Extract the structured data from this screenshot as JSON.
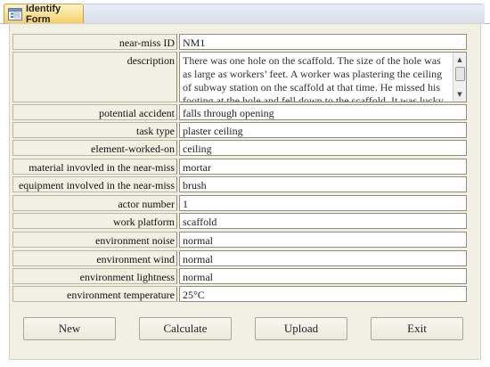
{
  "tab": {
    "icon": "form-icon",
    "title": "Identify Form"
  },
  "fields": [
    {
      "label": "near-miss ID",
      "value": "NM1"
    },
    {
      "label": "description",
      "value": "There was one hole on the scaffold. The size of the hole was as large as workers’ feet. A worker was plastering the ceiling of subway station on the scaffold at that time. He missed his footing at the hole and fell down to the scaffold. It was lucky"
    },
    {
      "label": "potential accident",
      "value": "falls through opening"
    },
    {
      "label": "task type",
      "value": "plaster ceiling"
    },
    {
      "label": "element-worked-on",
      "value": "ceiling"
    },
    {
      "label": "material invovled in the near-miss",
      "value": "mortar"
    },
    {
      "label": "equipment involved in the near-miss",
      "value": "brush"
    },
    {
      "label": "actor number",
      "value": "1"
    },
    {
      "label": "work platform",
      "value": "scaffold"
    },
    {
      "label": "environment noise",
      "value": "normal"
    },
    {
      "label": "environment wind",
      "value": "normal"
    },
    {
      "label": "environment lightness",
      "value": "normal"
    },
    {
      "label": "environment temperature",
      "value": "25°C"
    }
  ],
  "buttons": {
    "new": "New",
    "calculate": "Calculate",
    "upload": "Upload",
    "exit": "Exit"
  }
}
